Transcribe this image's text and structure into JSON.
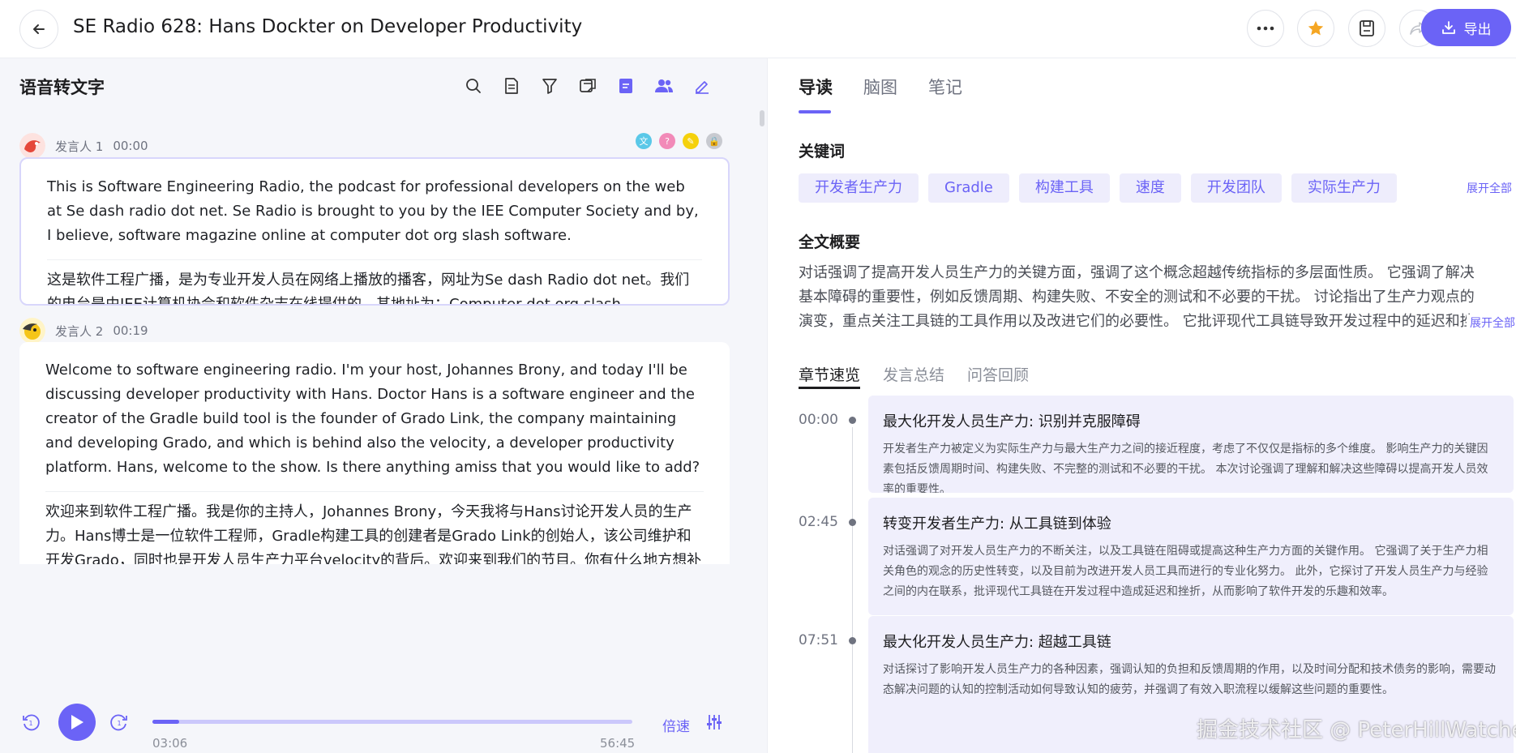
{
  "header": {
    "back_icon": "arrow-left-icon",
    "title": "SE Radio 628: Hans Dockter on Developer Productivity",
    "export_label": "导出",
    "colors": {
      "accent": "#6b63f6",
      "star": "#f5a623"
    }
  },
  "left": {
    "title": "语音转文字",
    "tool_icons": [
      "search-icon",
      "document-icon",
      "filter-icon",
      "translate-icon",
      "subtitle-icon",
      "speakers-icon",
      "edit-icon"
    ],
    "segments": [
      {
        "speaker": "发言人 1",
        "time": "00:00",
        "en": "This is Software Engineering Radio, the podcast for professional developers on the web at Se dash radio dot net. Se Radio is brought to you by the IEE Computer Society and by, I believe, software magazine online at computer dot org slash software.",
        "zh": "这是软件工程广播，是为专业开发人员在网络上播放的播客，网址为Se dash Radio dot net。我们的电台是由IEE计算机协会和软件杂志在线提供的，其地址为：Computer dot org slash software。"
      },
      {
        "speaker": "发言人 2",
        "time": "00:19",
        "en": "Welcome to software engineering radio. I'm your host, Johannes Brony, and today I'll be discussing developer productivity with Hans. Doctor Hans is a software engineer and the creator of the Gradle build tool is the founder of Grado Link, the company maintaining and developing Grado, and which is behind also the velocity, a developer productivity platform. Hans, welcome to the show. Is there anything amiss that you would like to add?",
        "zh": "欢迎来到软件工程广播。我是你的主持人，Johannes Brony，今天我将与Hans讨论开发人员的生产力。Hans博士是一位软件工程师，Gradle构建工具的创建者是Grado Link的创始人，该公司维护和开发Grado，同时也是开发人员生产力平台velocity的背后。欢迎来到我们的节目。你有什么地方想补充的吗?"
      }
    ],
    "player": {
      "current_time": "03:06",
      "total_time": "56:45",
      "progress": 0.055,
      "speed_label": "倍速"
    }
  },
  "right": {
    "tabs": [
      "导读",
      "脑图",
      "笔记"
    ],
    "active_tab": "导读",
    "keywords_title": "关键词",
    "keywords": [
      "开发者生产力",
      "Gradle",
      "构建工具",
      "速度",
      "开发团队",
      "实际生产力"
    ],
    "expand_label": "展开全部",
    "summary_title": "全文概要",
    "summary": "对话强调了提高开发人员生产力的关键方面，强调了这个概念超越传统指标的多层面性质。 它强调了解决基本障碍的重要性，例如反馈周期、构建失败、不安全的测试和不必要的干扰。 讨论指出了生产力观点的演变，重点关注工具链的工具作用以及改进它们的必要性。 它批评现代工具链导致开发过程中的延迟和挫折，...",
    "subtabs": [
      "章节速览",
      "发言总结",
      "问答回顾"
    ],
    "chapters": [
      {
        "time": "00:00",
        "title": "最大化开发人员生产力: 识别并克服障碍",
        "desc": "开发者生产力被定义为实际生产力与最大生产力之间的接近程度，考虑了不仅仅是指标的多个维度。 影响生产力的关键因素包括反馈周期时间、构建失败、不完整的测试和不必要的干扰。 本次讨论强调了理解和解决这些障碍以提高开发人员效率的重要性。"
      },
      {
        "time": "02:45",
        "title": "转变开发者生产力: 从工具链到体验",
        "desc": "对话强调了对开发人员生产力的不断关注，以及工具链在阻碍或提高这种生产力方面的关键作用。 它强调了关于生产力相关角色的观念的历史性转变，以及目前为改进开发人员工具而进行的专业化努力。 此外，它探讨了开发人员生产力与经验之间的内在联系，批评现代工具链在开发过程中造成延迟和挫折，从而影响了软件开发的乐趣和效率。"
      },
      {
        "time": "07:51",
        "title": "最大化开发人员生产力: 超越工具链",
        "desc": "对话探讨了影响开发人员生产力的各种因素，强调认知的负担和反馈周期的作用，以及时间分配和技术债务的影响，需要动态解决问题的认知的控制活动如何导致认知的疲劳，并强调了有效入职流程以缓解这些问题的重要性。"
      }
    ],
    "watermark": "掘金技术社区 @ PeterHillWatcher"
  }
}
